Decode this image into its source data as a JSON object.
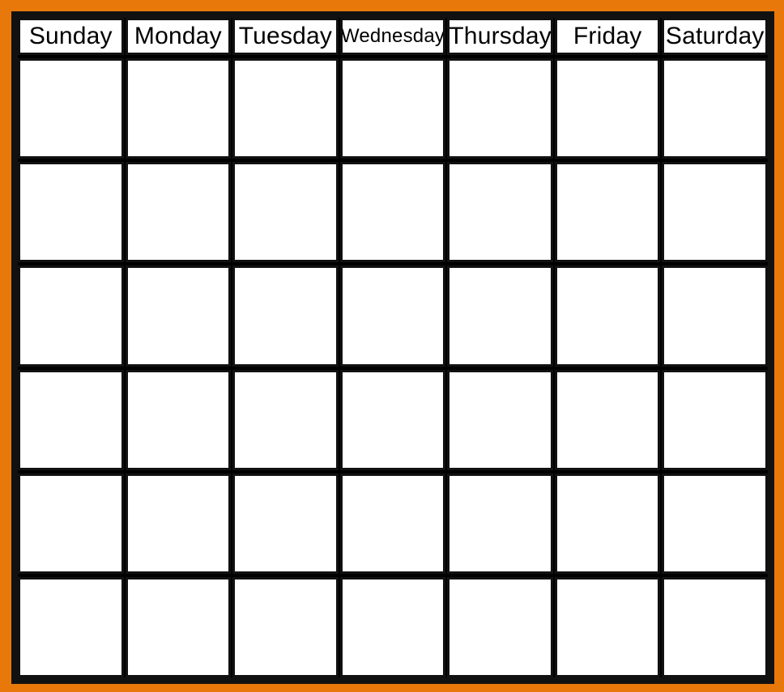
{
  "calendar": {
    "colors": {
      "outer_frame": "#e8780a",
      "grid_line": "#111111",
      "cell_background": "#ffffff"
    },
    "header": {
      "days": [
        {
          "label": "Sunday",
          "narrow": false
        },
        {
          "label": "Monday",
          "narrow": false
        },
        {
          "label": "Tuesday",
          "narrow": false
        },
        {
          "label": "Wednesday",
          "narrow": true
        },
        {
          "label": "Thursday",
          "narrow": false
        },
        {
          "label": "Friday",
          "narrow": false
        },
        {
          "label": "Saturday",
          "narrow": false
        }
      ]
    },
    "body": {
      "week_count": 6,
      "columns_per_week": 7,
      "weeks": [
        {
          "cells": [
            "",
            "",
            "",
            "",
            "",
            "",
            ""
          ]
        },
        {
          "cells": [
            "",
            "",
            "",
            "",
            "",
            "",
            ""
          ]
        },
        {
          "cells": [
            "",
            "",
            "",
            "",
            "",
            "",
            ""
          ]
        },
        {
          "cells": [
            "",
            "",
            "",
            "",
            "",
            "",
            ""
          ]
        },
        {
          "cells": [
            "",
            "",
            "",
            "",
            "",
            "",
            ""
          ]
        },
        {
          "cells": [
            "",
            "",
            "",
            "",
            "",
            "",
            ""
          ]
        }
      ]
    }
  }
}
